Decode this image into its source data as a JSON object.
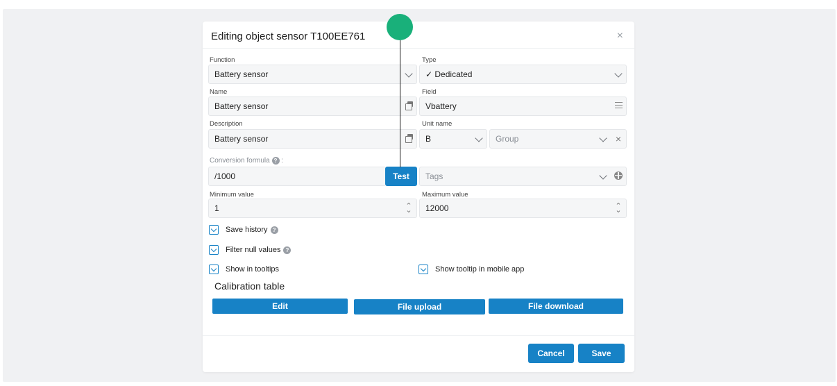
{
  "dialog": {
    "title": "Editing object sensor T100EE761",
    "close_glyph": "×"
  },
  "form": {
    "function": {
      "label": "Function",
      "value": "Battery sensor"
    },
    "type": {
      "label": "Type",
      "value": "✓ Dedicated"
    },
    "name": {
      "label": "Name",
      "value": "Battery sensor"
    },
    "field": {
      "label": "Field",
      "value": "Vbattery"
    },
    "description": {
      "label": "Description",
      "value": "Battery sensor"
    },
    "unit_name": {
      "label": "Unit name",
      "value": "B"
    },
    "group": {
      "placeholder": "Group"
    },
    "conversion_formula": {
      "label": "Conversion formula",
      "suffix": " :",
      "value": "/1000",
      "test_label": "Test"
    },
    "tags": {
      "placeholder": "Tags"
    },
    "minimum_value": {
      "label": "Minimum value",
      "value": "1"
    },
    "maximum_value": {
      "label": "Maximum value",
      "value": "12000"
    }
  },
  "checkboxes": {
    "save_history": {
      "label": "Save history",
      "checked": true
    },
    "filter_null_values": {
      "label": "Filter null values",
      "checked": true
    },
    "show_in_tooltips": {
      "label": "Show in tooltips",
      "checked": true
    },
    "show_tooltip_mobile": {
      "label": "Show tooltip in mobile app",
      "checked": true
    }
  },
  "calibration": {
    "title": "Calibration table",
    "edit_label": "Edit",
    "upload_label": "File upload",
    "download_label": "File download"
  },
  "footer": {
    "cancel_label": "Cancel",
    "save_label": "Save"
  },
  "icons": {
    "help_glyph": "?",
    "clear_glyph": "×",
    "spin_up": "⌃",
    "spin_down": "⌄"
  },
  "colors": {
    "accent": "#1782c6",
    "marker": "#19b07a",
    "backdrop": "#f0f1f3"
  }
}
